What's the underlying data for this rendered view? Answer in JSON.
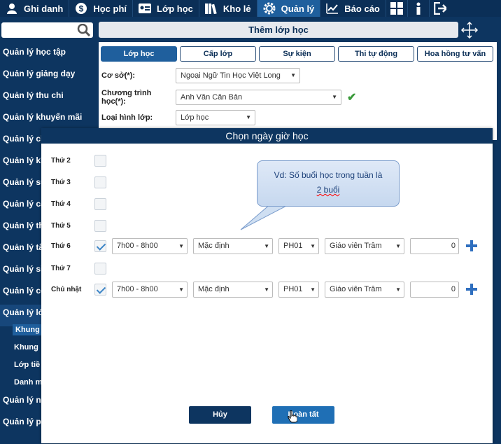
{
  "topnav": {
    "items": [
      {
        "label": "Ghi danh",
        "icon": "user-icon"
      },
      {
        "label": "Học phí",
        "icon": "dollar-icon"
      },
      {
        "label": "Lớp học",
        "icon": "id-card-icon"
      },
      {
        "label": "Kho lẻ",
        "icon": "books-icon"
      },
      {
        "label": "Quản lý",
        "icon": "gear-icon"
      },
      {
        "label": "Báo cáo",
        "icon": "chart-icon"
      }
    ]
  },
  "sidebar": {
    "search_placeholder": "",
    "items": [
      "Quản lý học tập",
      "Quản lý giảng dạy",
      "Quản lý thu chi",
      "Quản lý khuyến mãi",
      "Quản lý ch",
      "Quản lý kh",
      "Quản lý su",
      "Quản lý ca",
      "Quản lý th",
      "Quản lý tâ",
      "Quản lý si",
      "Quản lý cơ",
      "Quản lý lớ"
    ],
    "subitems": [
      "Khung",
      "Khung",
      "Lớp tiề",
      "Danh m"
    ],
    "items_after": [
      "Quản lý ng",
      "Quản lý ph"
    ]
  },
  "panel": {
    "title": "Thêm lớp học",
    "tabs": [
      "Lớp học",
      "Cấp lớp",
      "Sự kiện",
      "Thi tự động",
      "Hoa hồng tư vấn"
    ],
    "form": {
      "co_so_label": "Cơ sở(*):",
      "co_so_value": "Ngoại Ngữ Tin Học Việt Long",
      "chuong_trinh_label": "Chương trình học(*):",
      "chuong_trinh_value": "Anh Văn Căn Bản",
      "loai_hinh_label": "Loại hình lớp:",
      "loai_hinh_value": "Lớp học"
    }
  },
  "modal": {
    "title": "Chọn ngày giờ học",
    "days": [
      {
        "label": "Thứ 2"
      },
      {
        "label": "Thứ 3"
      },
      {
        "label": "Thứ 4"
      },
      {
        "label": "Thứ 5"
      },
      {
        "label": "Thứ 6",
        "time": "7h00 - 8h00",
        "mode": "Mặc định",
        "room": "PH01",
        "teacher": "Giáo viên Trâm",
        "count": "0"
      },
      {
        "label": "Thứ 7"
      },
      {
        "label": "Chủ nhật",
        "time": "7h00 - 8h00",
        "mode": "Mặc định",
        "room": "PH01",
        "teacher": "Giáo viên Trâm",
        "count": "0"
      }
    ],
    "callout_line1": "Vd: Số buổi học trong tuần là",
    "callout_line2": "2 buổi",
    "cancel_label": "Hủy",
    "ok_label": "Hoàn tất"
  }
}
